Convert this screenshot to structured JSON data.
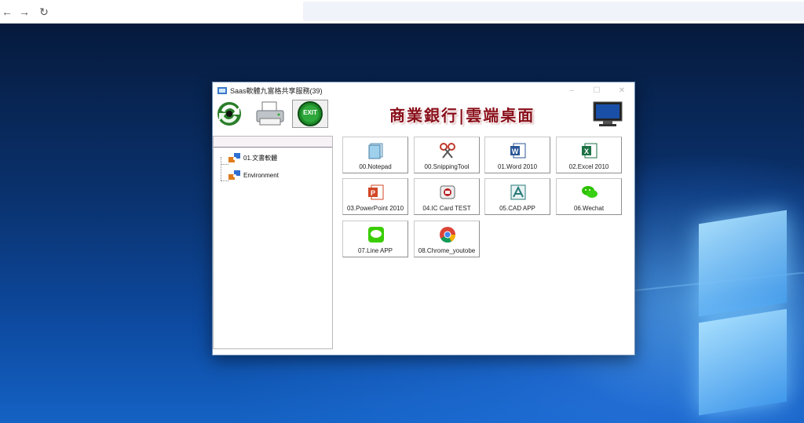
{
  "browser": {
    "back_icon": "←",
    "forward_icon": "→",
    "reload_icon": "↻",
    "url": ""
  },
  "app": {
    "title": "Saas軟體九富格共享服務(39)",
    "controls": {
      "minimize": "–",
      "maximize": "☐",
      "close": "✕"
    },
    "toolbar": {
      "sync_icon": "sync-icon",
      "print_icon": "printer-icon",
      "exit_label": "EXIT"
    },
    "banner_text": "商業銀行|雲端桌面",
    "tree": {
      "items": [
        {
          "label": "01.文書軟體",
          "icon": "app-group-icon"
        },
        {
          "label": "Environment",
          "icon": "app-group-icon"
        }
      ]
    },
    "apps": [
      {
        "label": "00.Notepad",
        "icon": "notepad-icon"
      },
      {
        "label": "00.SnippingTool",
        "icon": "scissors-icon"
      },
      {
        "label": "01.Word 2010",
        "icon": "word-icon"
      },
      {
        "label": "02.Excel 2010",
        "icon": "excel-icon"
      },
      {
        "label": "03.PowerPoint 2010",
        "icon": "powerpoint-icon"
      },
      {
        "label": "04.IC Card TEST",
        "icon": "ic-card-icon"
      },
      {
        "label": "05.CAD APP",
        "icon": "cad-icon"
      },
      {
        "label": "06.Wechat",
        "icon": "wechat-icon"
      },
      {
        "label": "07.Line APP",
        "icon": "line-icon"
      },
      {
        "label": "08.Chrome_youtobe",
        "icon": "chrome-icon"
      }
    ]
  },
  "colors": {
    "banner": "#8a0f1a",
    "exit_green": "#2e8b2e",
    "word_blue": "#2b5797",
    "excel_green": "#1e7145",
    "ppt_orange": "#d24726",
    "line_green": "#3acd01",
    "wechat_green": "#2dc100"
  }
}
